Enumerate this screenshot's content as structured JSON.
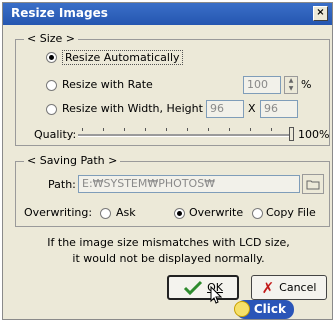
{
  "window": {
    "title": "Resize Images",
    "close_glyph": "×"
  },
  "size_group": {
    "legend": "< Size >",
    "option_auto": "Resize Automatically",
    "option_rate": "Resize with Rate",
    "rate_value": "100",
    "rate_unit": "%",
    "option_wh": "Resize with Width, Height",
    "width_value": "96",
    "height_value": "96",
    "times": "X",
    "quality_label": "Quality:",
    "quality_value": "100%",
    "quality_level_percent": 100,
    "selected": "auto"
  },
  "path_group": {
    "legend": "< Saving Path >",
    "path_label": "Path:",
    "path_value": "E:₩SYSTEM₩PHOTOS₩",
    "overwriting_label": "Overwriting:",
    "opt_ask": "Ask",
    "opt_overwrite": "Overwrite",
    "opt_copy": "Copy File",
    "selected": "overwrite"
  },
  "message": {
    "line1": "If the image size mismatches with LCD size,",
    "line2": "it would not be displayed normally."
  },
  "buttons": {
    "ok": "OK",
    "cancel": "Cancel"
  },
  "annotation": {
    "click": "Click"
  },
  "colors": {
    "title_bar": "#2556b0",
    "accent_click": "#2a55b8"
  }
}
